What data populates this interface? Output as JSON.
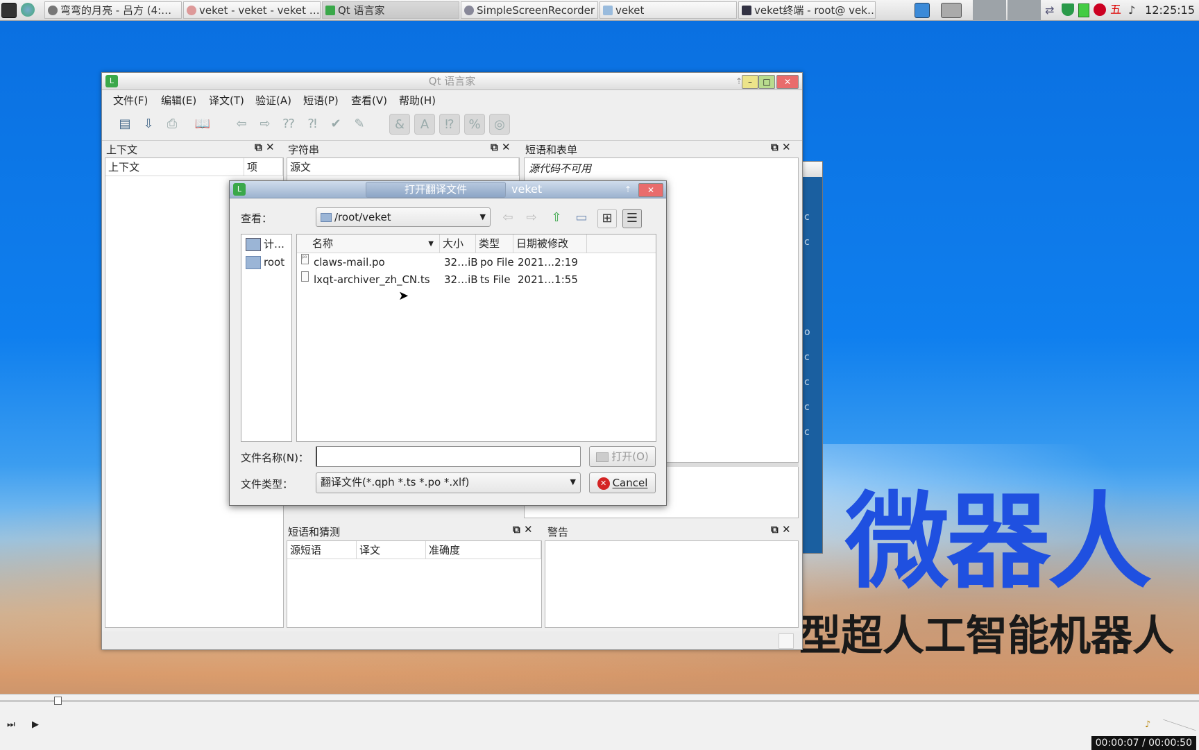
{
  "taskbar": {
    "tasks": [
      {
        "label": "弯弯的月亮 - 吕方 (4:…"
      },
      {
        "label": "veket - veket - veket …"
      },
      {
        "label": "Qt 语言家"
      },
      {
        "label": "SimpleScreenRecorder"
      },
      {
        "label": "veket"
      },
      {
        "label": "veket终端 - root@ vek…"
      }
    ],
    "ime_label": "五",
    "clock": "12:25:15"
  },
  "main_window": {
    "title": "Qt 语言家",
    "menus": [
      "文件(F)",
      "编辑(E)",
      "译文(T)",
      "验证(A)",
      "短语(P)",
      "查看(V)",
      "帮助(H)"
    ],
    "context_panel": {
      "title": "上下文",
      "columns": [
        "上下文",
        "项"
      ]
    },
    "strings_panel": {
      "title": "字符串",
      "columns": [
        "源文"
      ]
    },
    "phrases_panel": {
      "title": "短语和表单",
      "message": "源代码不可用"
    },
    "guess_panel": {
      "title": "短语和猜测",
      "columns": [
        "源短语",
        "译文",
        "准确度"
      ]
    },
    "warnings_panel": {
      "title": "警告"
    }
  },
  "dialog": {
    "title": "打开翻译文件",
    "title_suffix": "veket",
    "look_in_label": "查看：",
    "look_in_value": "/root/veket",
    "sidebar": [
      {
        "label": "计…",
        "icon": "computer-icon"
      },
      {
        "label": "root",
        "icon": "folder-icon"
      }
    ],
    "columns": [
      "名称",
      "大小",
      "类型",
      "日期被修改"
    ],
    "files": [
      {
        "name": "claws-mail.po",
        "size": "32…iB",
        "type": "po File",
        "date": "2021…2:19",
        "icon_text": "po"
      },
      {
        "name": "lxqt-archiver_zh_CN.ts",
        "size": "32…iB",
        "type": "ts File",
        "date": "2021…1:55",
        "icon_text": ""
      }
    ],
    "filename_label": "文件名称(N)：",
    "filename_value": "",
    "filetype_label": "文件类型：",
    "filetype_value": "翻译文件(*.qph *.ts *.po *.xlf)",
    "open_button": "打开(O)",
    "cancel_button": "Cancel"
  },
  "behind_window_letters": [
    "c",
    "c",
    "o",
    "c",
    "c",
    "c",
    "c"
  ],
  "wallpaper": {
    "headline": "微器人",
    "subline": "型超人工智能机器人"
  },
  "player": {
    "time": "00:00:07 / 00:00:50"
  },
  "colors": {
    "accent_blue": "#1f50e0",
    "desktop_blue": "#0f7fee"
  }
}
